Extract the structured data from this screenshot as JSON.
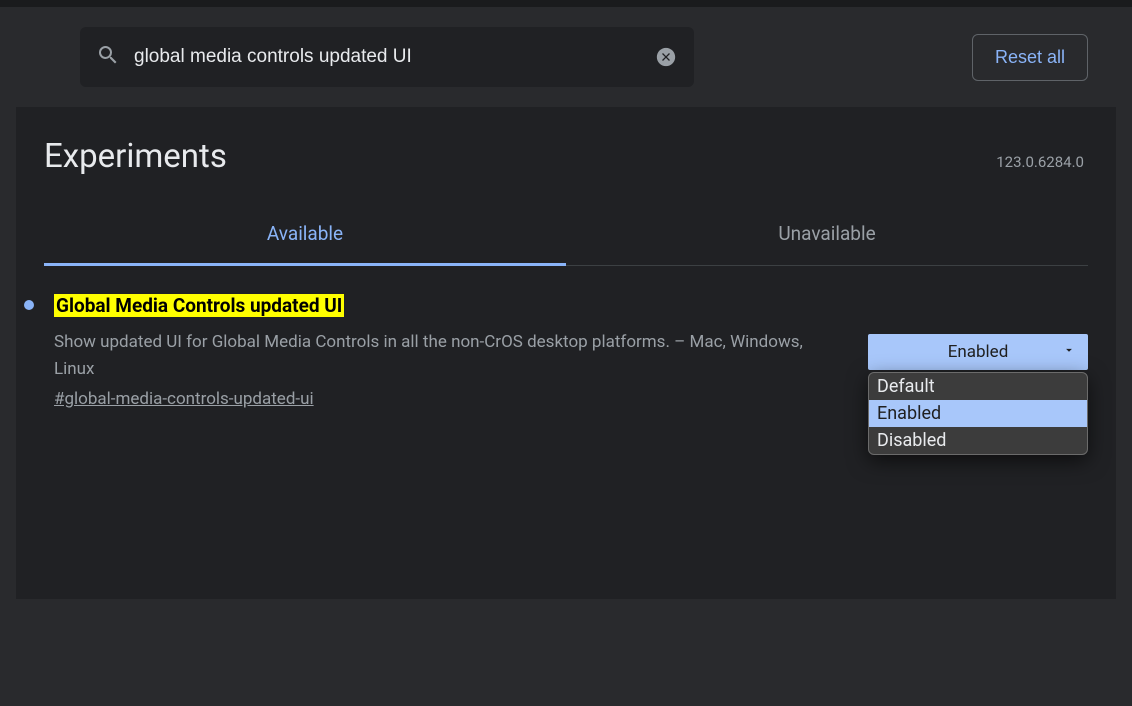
{
  "header": {
    "search_value": "global media controls updated UI",
    "reset_label": "Reset all"
  },
  "page": {
    "title": "Experiments",
    "version": "123.0.6284.0"
  },
  "tabs": {
    "available": "Available",
    "unavailable": "Unavailable"
  },
  "flag": {
    "title": "Global Media Controls updated UI",
    "description": "Show updated UI for Global Media Controls in all the non-CrOS desktop platforms. – Mac, Windows, Linux",
    "hash": "#global-media-controls-updated-ui",
    "selected": "Enabled",
    "options": {
      "default": "Default",
      "enabled": "Enabled",
      "disabled": "Disabled"
    }
  }
}
